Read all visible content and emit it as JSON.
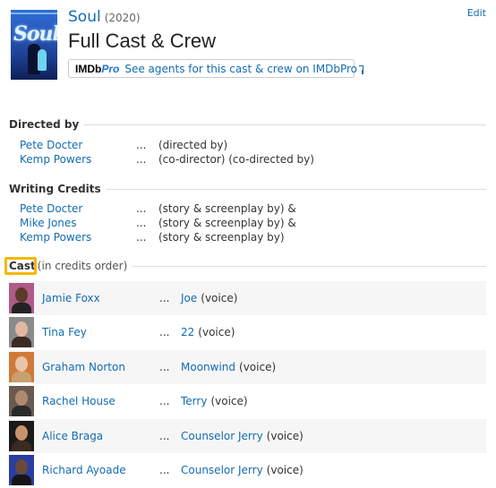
{
  "header": {
    "movie_title": "Soul",
    "year": "(2020)",
    "page_title": "Full Cast & Crew",
    "pro_logo_left": "IMDb",
    "pro_logo_right": "Pro",
    "pro_link_text": "See agents for this cast & crew on IMDbPro",
    "edit_label": "Edit",
    "poster_text": "Soul"
  },
  "directed_by": {
    "heading": "Directed by",
    "rows": [
      {
        "name": "Pete Docter",
        "dots": "...",
        "role": "(directed by)"
      },
      {
        "name": "Kemp Powers",
        "dots": "...",
        "role": "(co-director) (co-directed by)"
      }
    ]
  },
  "writing_credits": {
    "heading": "Writing Credits",
    "rows": [
      {
        "name": "Pete Docter",
        "dots": "...",
        "role": "(story & screenplay by) &"
      },
      {
        "name": "Mike Jones",
        "dots": "...",
        "role": "(story & screenplay by) &"
      },
      {
        "name": "Kemp Powers",
        "dots": "...",
        "role": "(story & screenplay by)"
      }
    ]
  },
  "cast": {
    "heading": "Cast",
    "subheading": "(in credits order)",
    "rows": [
      {
        "actor": "Jamie Foxx",
        "dots": "...",
        "character": "Joe",
        "note": "(voice)"
      },
      {
        "actor": "Tina Fey",
        "dots": "...",
        "character": "22",
        "note": "(voice)"
      },
      {
        "actor": "Graham Norton",
        "dots": "...",
        "character": "Moonwind",
        "note": "(voice)"
      },
      {
        "actor": "Rachel House",
        "dots": "...",
        "character": "Terry",
        "note": "(voice)"
      },
      {
        "actor": "Alice Braga",
        "dots": "...",
        "character": "Counselor Jerry",
        "note": "(voice)"
      },
      {
        "actor": "Richard Ayoade",
        "dots": "...",
        "character": "Counselor Jerry",
        "note": "(voice)"
      }
    ]
  },
  "colors": {
    "link": "#136cb2",
    "highlight": "#f5b800",
    "row_alt": "#f6f6f6"
  }
}
